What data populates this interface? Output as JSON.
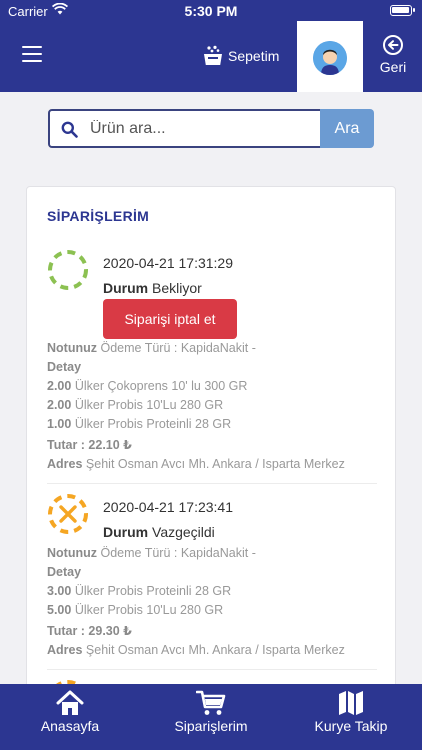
{
  "status_bar": {
    "carrier": "Carrier",
    "time": "5:30 PM"
  },
  "header": {
    "cart_label": "Sepetim",
    "back_label": "Geri"
  },
  "search": {
    "placeholder": "Ürün ara...",
    "button_label": "Ara"
  },
  "orders_title": "SİPARİŞLERİM",
  "orders": [
    {
      "date": "2020-04-21 17:31:29",
      "status_label": "Durum",
      "status_value": "Bekliyor",
      "status_color": "#8cc152",
      "cancel_label": "Siparişi iptal et",
      "note_label": "Notunuz",
      "note_value": "Ödeme Türü : KapidaNakit -",
      "detail_label": "Detay",
      "items": [
        {
          "qty": "2.00",
          "name": "Ülker Çokoprens 10' lu 300 GR"
        },
        {
          "qty": "2.00",
          "name": "Ülker Probis 10'Lu 280 GR"
        },
        {
          "qty": "1.00",
          "name": "Ülker Probis Proteinli 28 GR"
        }
      ],
      "total_label": "Tutar : 22.10 ₺",
      "address_label": "Adres",
      "address_value": "Şehit Osman Avcı Mh. Ankara / Isparta Merkez"
    },
    {
      "date": "2020-04-21 17:23:41",
      "status_label": "Durum",
      "status_value": "Vazgeçildi",
      "status_color": "#f5a623",
      "note_label": "Notunuz",
      "note_value": "Ödeme Türü : KapidaNakit -",
      "detail_label": "Detay",
      "items": [
        {
          "qty": "3.00",
          "name": "Ülker Probis Proteinli 28 GR"
        },
        {
          "qty": "5.00",
          "name": "Ülker Probis 10'Lu 280 GR"
        }
      ],
      "total_label": "Tutar : 29.30 ₺",
      "address_label": "Adres",
      "address_value": "Şehit Osman Avcı Mh. Ankara / Isparta Merkez"
    }
  ],
  "tabbar": [
    {
      "label": "Anasayfa",
      "icon": "home-icon"
    },
    {
      "label": "Siparişlerim",
      "icon": "cart-icon"
    },
    {
      "label": "Kurye Takip",
      "icon": "map-icon"
    }
  ],
  "colors": {
    "primary": "#2c3691",
    "search_button": "#6c9bd2",
    "cancel": "#d93a45"
  }
}
